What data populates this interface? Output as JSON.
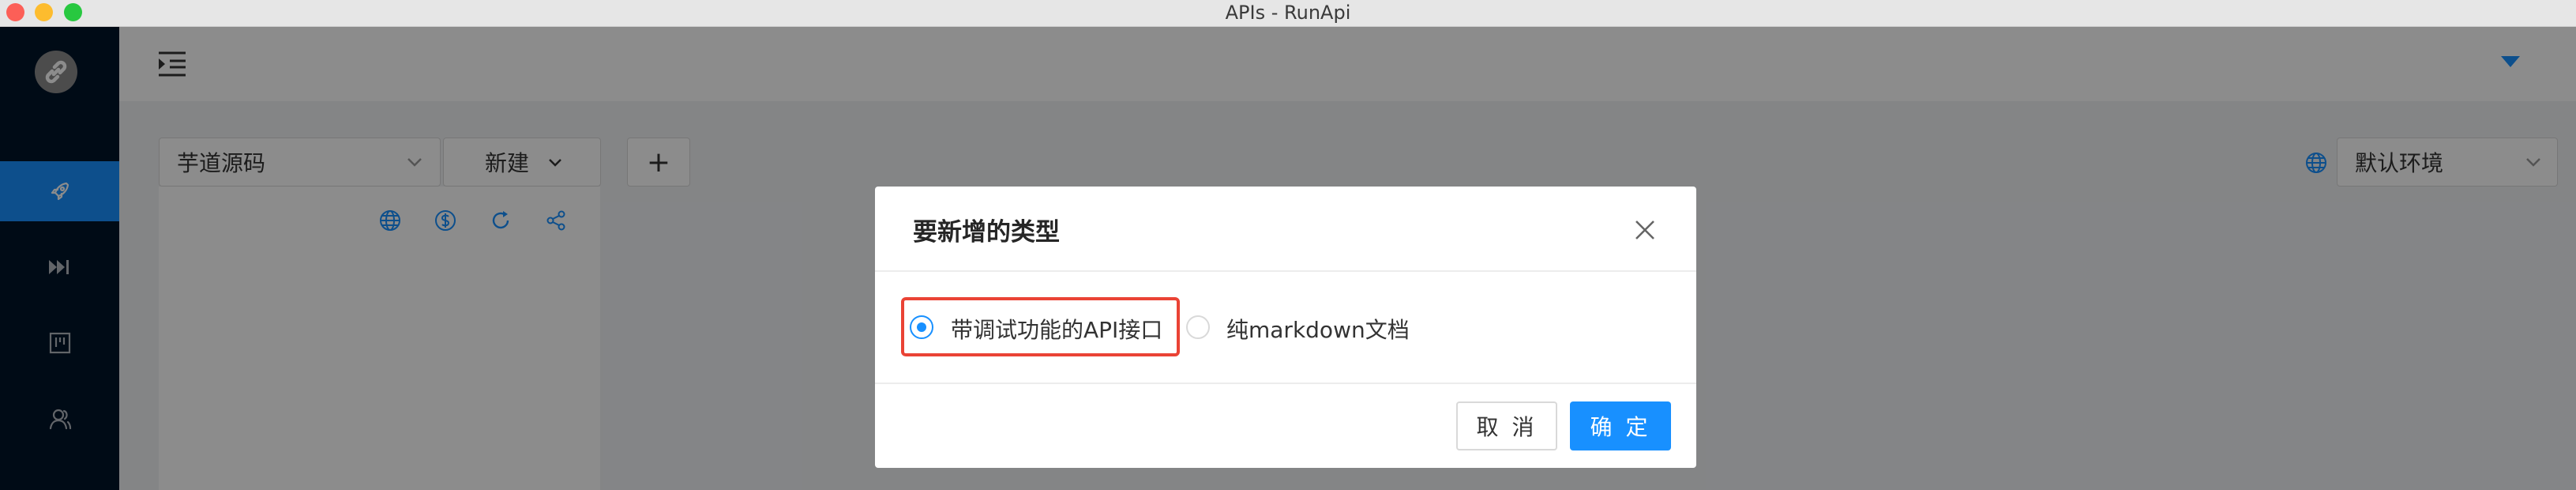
{
  "window": {
    "title": "APIs - RunApi"
  },
  "sidebar": {
    "logo_icon": "link-icon",
    "items": [
      {
        "icon": "rocket-icon",
        "active": true
      },
      {
        "icon": "fast-forward-icon",
        "active": false
      },
      {
        "icon": "kanban-icon",
        "active": false
      },
      {
        "icon": "users-icon",
        "active": false
      }
    ]
  },
  "toolbar": {
    "project_select": "芋道源码",
    "new_button": "新建",
    "add_button": "+",
    "env_select": "默认环境"
  },
  "panel": {
    "icons": [
      "globe-icon",
      "dollar-icon",
      "refresh-icon",
      "share-icon"
    ]
  },
  "modal": {
    "title": "要新增的类型",
    "options": [
      {
        "label": "带调试功能的API接口",
        "selected": true
      },
      {
        "label": "纯markdown文档",
        "selected": false
      }
    ],
    "cancel_label": "取 消",
    "ok_label": "确 定"
  },
  "colors": {
    "accent": "#1890ff",
    "sidebar": "#001529",
    "highlight": "#ea4335"
  }
}
